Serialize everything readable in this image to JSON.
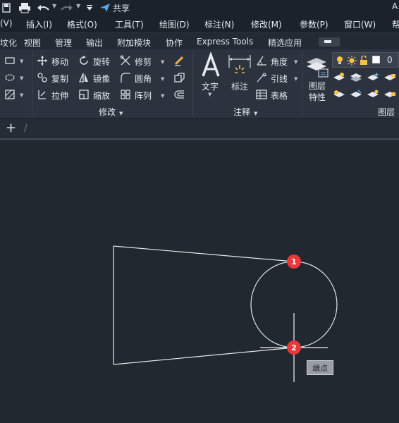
{
  "quick_access": {
    "share_label": "共享",
    "title_fragment": "A"
  },
  "menu": {
    "items": [
      "(V)",
      "插入(I)",
      "格式(O)",
      "工具(T)",
      "绘图(D)",
      "标注(N)",
      "修改(M)",
      "参数(P)",
      "窗口(W)",
      "帮"
    ]
  },
  "ribbon_tabs": [
    "坟化",
    "视图",
    "管理",
    "输出",
    "附加模块",
    "协作",
    "Express Tools",
    "精选应用"
  ],
  "ribbon": {
    "modify": {
      "title": "修改",
      "tools": [
        "移动",
        "旋转",
        "修剪",
        "复制",
        "镜像",
        "圆角",
        "拉伸",
        "缩放",
        "阵列"
      ]
    },
    "annotation": {
      "title": "注释",
      "text_label": "文字",
      "dimension_label": "标注",
      "angle_label": "角度",
      "leader_label": "引线",
      "table_label": "表格"
    },
    "layers": {
      "title": "图层",
      "properties_line1": "图层",
      "properties_line2": "特性",
      "current_layer": "0"
    }
  },
  "canvas": {
    "markers": [
      "1",
      "2"
    ],
    "tooltip": "端点"
  },
  "colors": {
    "canvas_bg": "#212830",
    "ribbon_bg": "#2c333e",
    "menu_bg": "#1c222b",
    "marker_red": "#e9373a",
    "lines": "#e6e6e6"
  }
}
